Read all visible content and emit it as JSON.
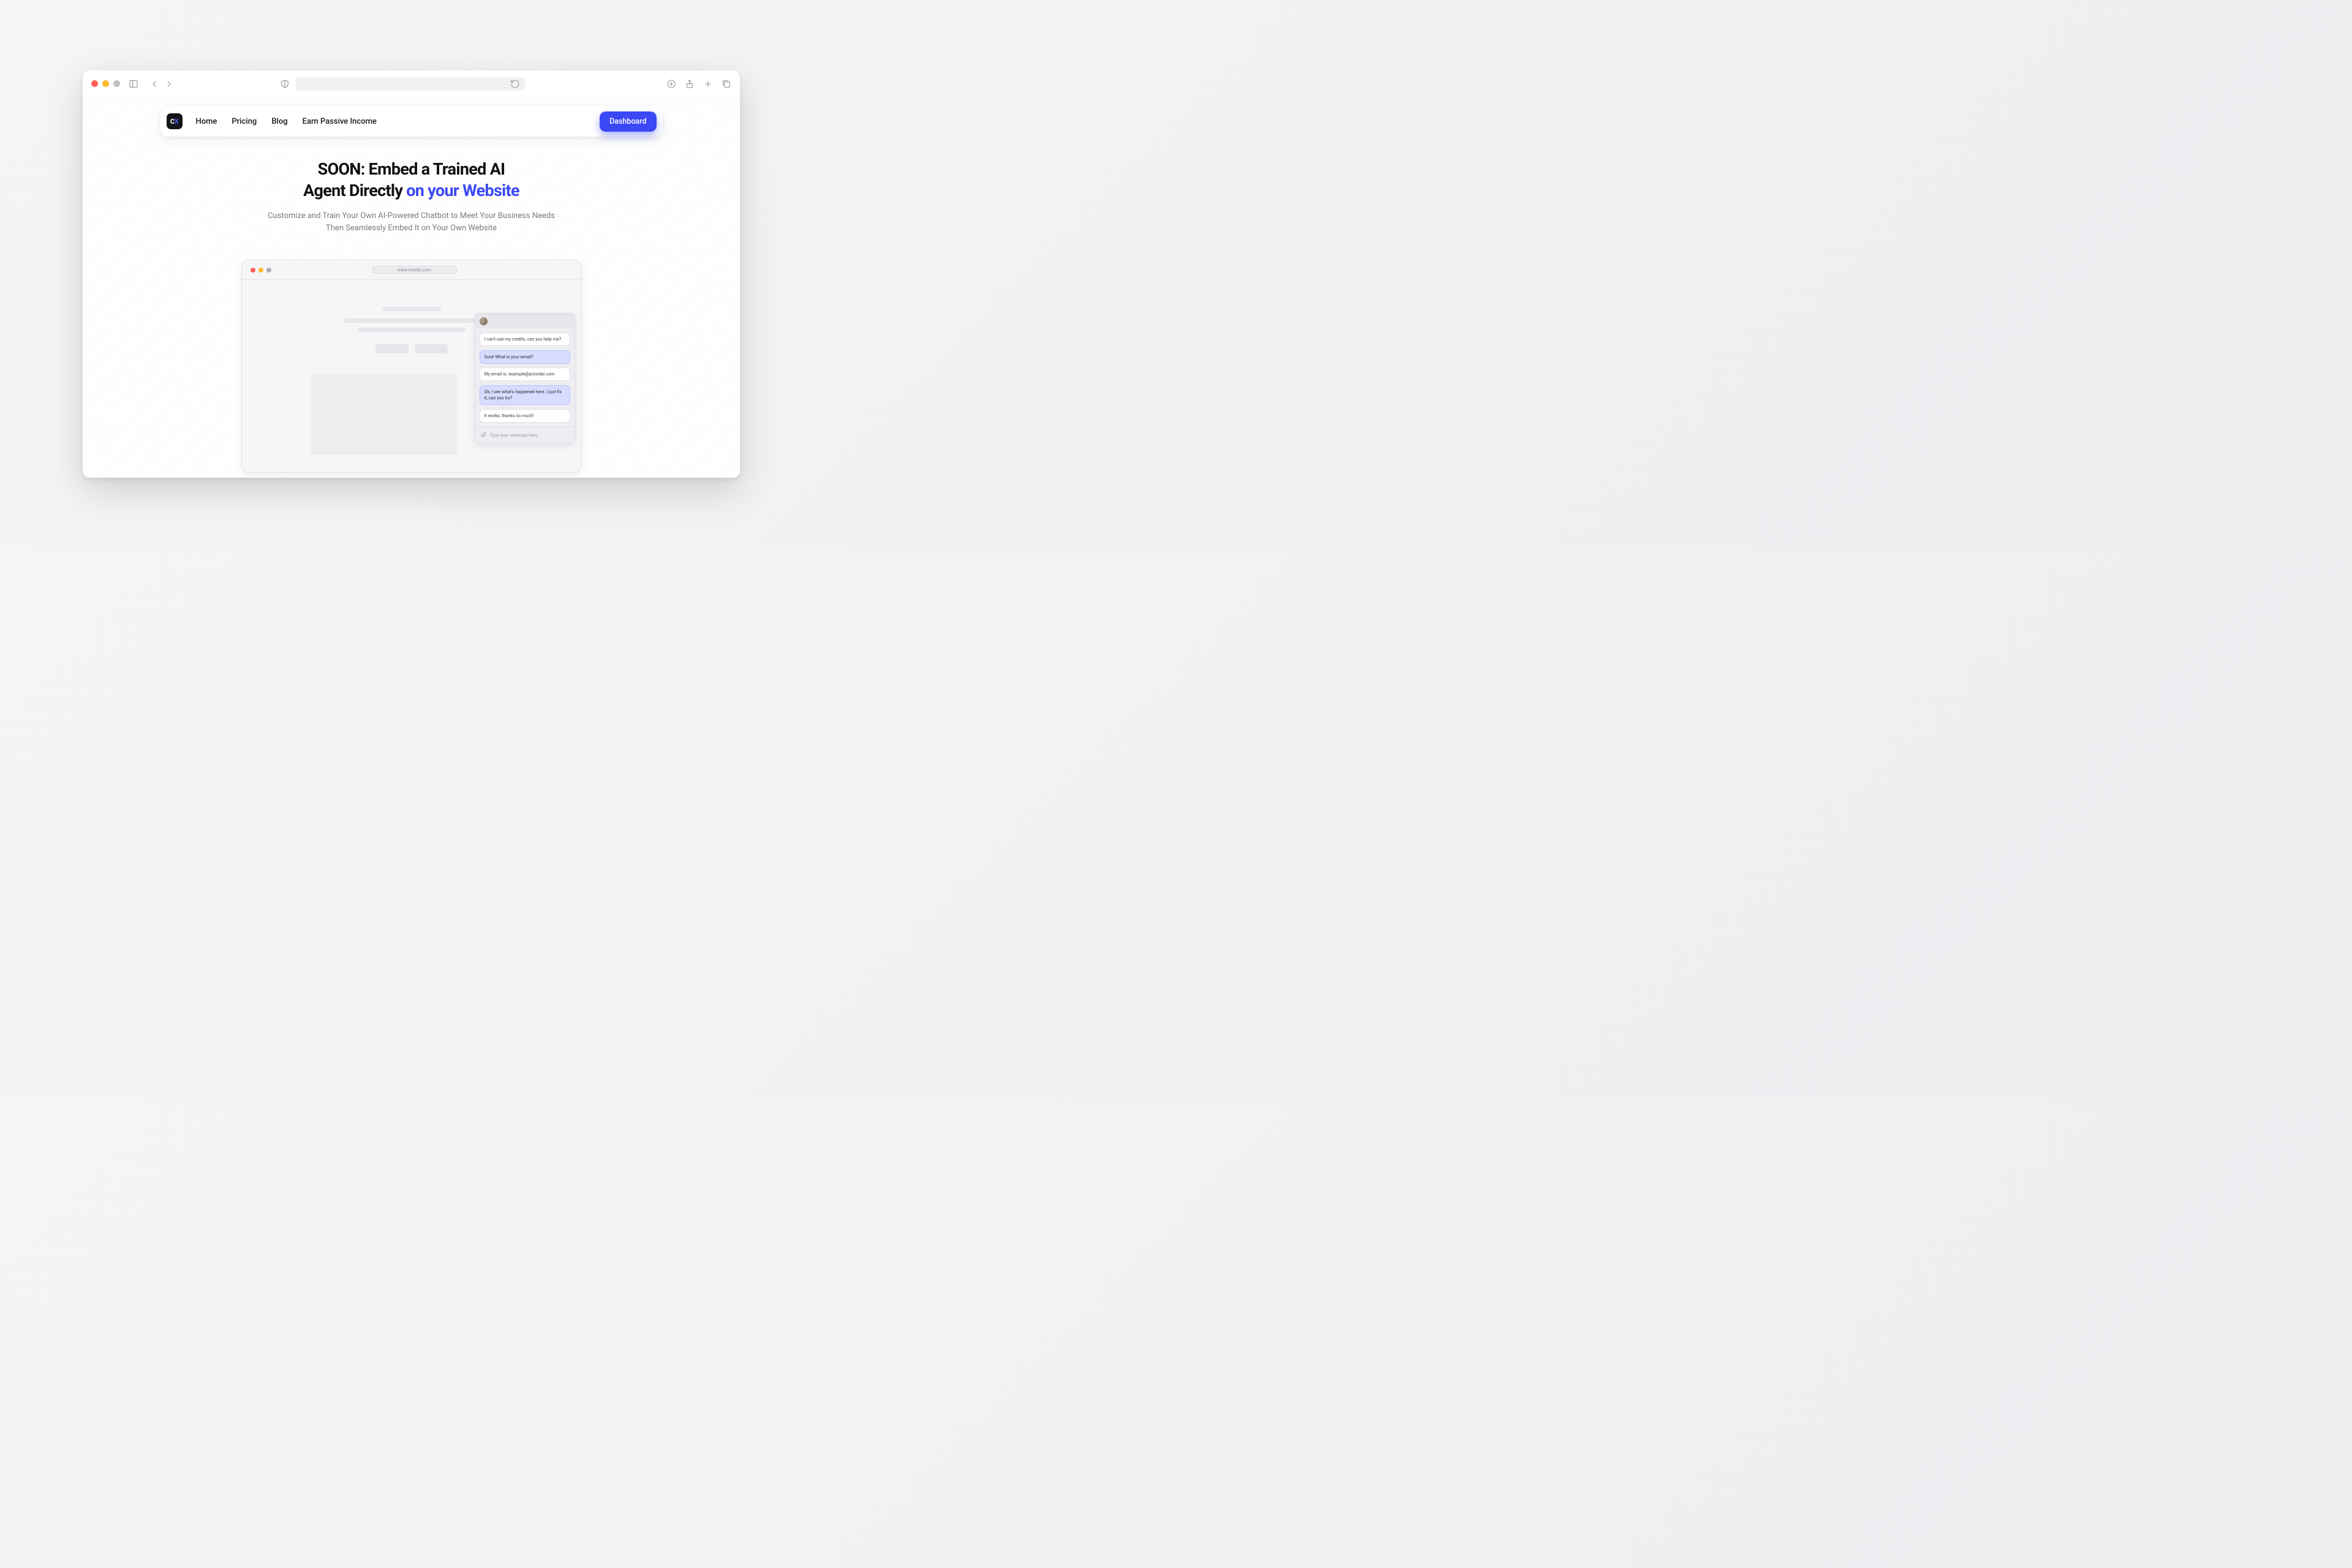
{
  "nav": {
    "logo": {
      "c": "C",
      "x": "X"
    },
    "links": [
      "Home",
      "Pricing",
      "Blog",
      "Earn Passive Income"
    ],
    "dashboard": "Dashboard"
  },
  "hero": {
    "title_line1": "SOON: Embed a Trained AI",
    "title_line2_plain": "Agent Directly ",
    "title_line2_accent": "on your Website",
    "subtitle_line1": "Customize and Train Your Own AI-Powered Chatbot to Meet Your Business Needs",
    "subtitle_line2": "Then Seamlessly Embed It on Your Own Website"
  },
  "mockup": {
    "url": "www.mysite.com",
    "chat": {
      "messages": [
        {
          "role": "user",
          "text": "I can't use my credits, can you help me?"
        },
        {
          "role": "agent",
          "text": "Sure! What is your email?"
        },
        {
          "role": "user",
          "text": "My email is: example@provider.com"
        },
        {
          "role": "agent",
          "text": "Ok, I see what's happened here. I just fix it, can you try?"
        },
        {
          "role": "user",
          "text": "It works, thanks so much!"
        }
      ],
      "placeholder": "Type your message here..."
    }
  }
}
